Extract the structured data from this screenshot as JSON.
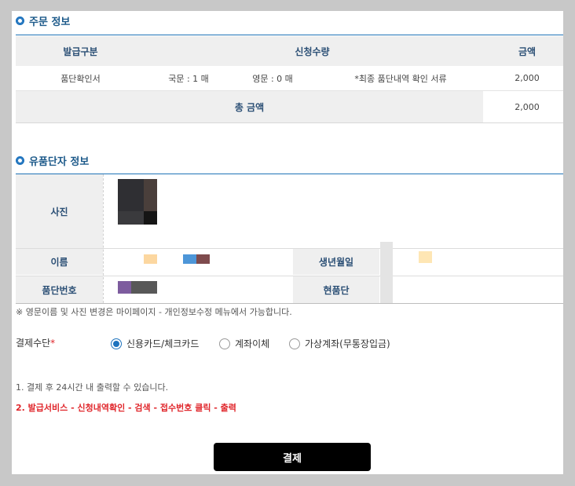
{
  "order": {
    "section_title": "주문 정보",
    "headers": {
      "type": "발급구분",
      "qty": "신청수량",
      "amount": "금액"
    },
    "row": {
      "type": "품단확인서",
      "korean": "국문 : 1 매",
      "english": "영문 : 0 매",
      "note": "*최종 품단내역 확인 서류",
      "amount": "2,000"
    },
    "total_label": "총 금액",
    "total_amount": "2,000"
  },
  "person": {
    "section_title": "유품단자 정보",
    "labels": {
      "photo": "사진",
      "name": "이름",
      "dan_no": "품단번호",
      "birth": "생년월일",
      "current_dan": "현품단"
    }
  },
  "notice": "※ 영문이름 및 사진 변경은 마이페이지 - 개인정보수정 메뉴에서 가능합니다.",
  "payment": {
    "label": "결제수단",
    "required_mark": "*",
    "options": [
      {
        "label": "신용카드/체크카드",
        "selected": true
      },
      {
        "label": "계좌이체",
        "selected": false
      },
      {
        "label": "가상계좌(무통장입금)",
        "selected": false
      }
    ]
  },
  "info": {
    "line1": "1. 결제 후 24시간 내 출력할 수 있습니다.",
    "line2": "2. 발급서비스 - 신청내역확인 - 검색 - 접수번호 클릭 - 출력"
  },
  "pay_button": "결제",
  "colors": {
    "accent": "#1e73be",
    "warning": "#e0262b",
    "button": "#000000"
  }
}
